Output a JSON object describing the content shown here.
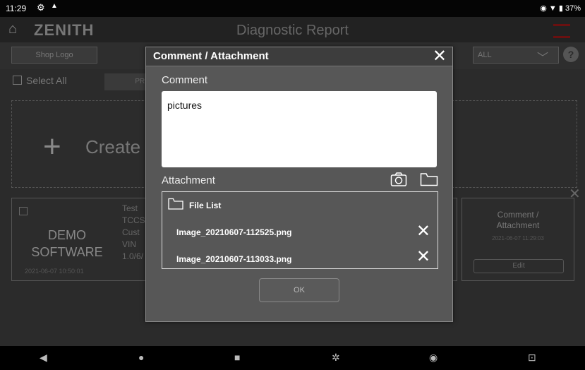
{
  "status_bar": {
    "time": "11:29",
    "battery": "37%"
  },
  "app": {
    "logo": "ZENITH",
    "title": "Diagnostic Report",
    "shop_logo": "Shop Logo",
    "filter_value": "ALL",
    "help": "?",
    "select_all": "Select All",
    "tab_partial": "PRI",
    "create_label": "Create",
    "report_card": {
      "demo_line1": "DEMO",
      "demo_line2": "SOFTWARE",
      "date": "2021-06-07 10:50:01",
      "col1": "Test",
      "col2": "TCCS",
      "col3": "Cust",
      "col4": "VIN",
      "col5": "1.0/6/"
    },
    "comment_card": {
      "title_line1": "Comment /",
      "title_line2": "Attachment",
      "sub": "2021-06-07 11:29:03",
      "edit": "Edit"
    }
  },
  "dialog": {
    "title": "Comment / Attachment",
    "comment_label": "Comment",
    "comment_value": "pictures",
    "attachment_label": "Attachment",
    "file_list_label": "File List",
    "files": [
      "Image_20210607-112525.png",
      "Image_20210607-113033.png"
    ],
    "ok_label": "OK"
  },
  "icons": {
    "camera": "camera-icon",
    "folder": "folder-icon",
    "close": "close-icon"
  }
}
